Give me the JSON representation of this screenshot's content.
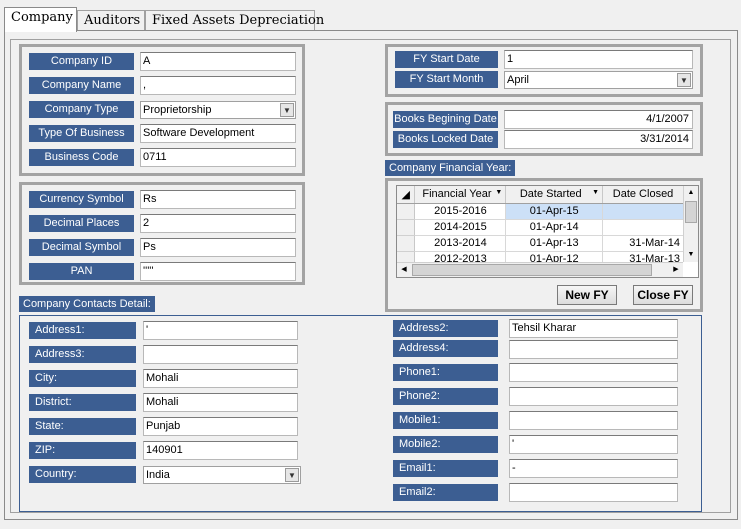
{
  "tabs": [
    "Company",
    "Auditors",
    "Fixed Assets Depreciation"
  ],
  "company_info": {
    "company_id": {
      "label": "Company ID",
      "value": "A"
    },
    "company_name": {
      "label": "Company Name",
      "value": ","
    },
    "company_type": {
      "label": "Company Type",
      "value": "Proprietorship"
    },
    "type_of_business": {
      "label": "Type Of Business",
      "value": "Software Development"
    },
    "business_code": {
      "label": "Business Code",
      "value": "0711"
    }
  },
  "currency": {
    "currency_symbol": {
      "label": "Currency Symbol",
      "value": "Rs"
    },
    "decimal_places": {
      "label": "Decimal Places",
      "value": "2"
    },
    "decimal_symbol": {
      "label": "Decimal Symbol",
      "value": "Ps"
    },
    "pan": {
      "label": "PAN",
      "value": "'''''"
    }
  },
  "fiscal": {
    "fy_start_date": {
      "label": "FY Start Date",
      "value": "1"
    },
    "fy_start_month": {
      "label": "FY Start Month",
      "value": "April"
    }
  },
  "books": {
    "begining_date": {
      "label": "Books Begining Date",
      "value": "4/1/2007"
    },
    "locked_date": {
      "label": "Books Locked Date",
      "value": "3/31/2014"
    }
  },
  "financial_year": {
    "caption": "Company Financial Year:",
    "columns": [
      "Financial Year",
      "Date Started",
      "Date Closed"
    ],
    "rows": [
      {
        "year": "2015-2016",
        "started": "01-Apr-15",
        "closed": ""
      },
      {
        "year": "2014-2015",
        "started": "01-Apr-14",
        "closed": ""
      },
      {
        "year": "2013-2014",
        "started": "01-Apr-13",
        "closed": "31-Mar-14"
      },
      {
        "year": "2012-2013",
        "started": "01-Apr-12",
        "closed": "31-Mar-13"
      }
    ],
    "new_fy": "New FY",
    "close_fy": "Close FY"
  },
  "contacts": {
    "caption": "Company Contacts Detail:",
    "address1": {
      "label": "Address1:",
      "value": "'"
    },
    "address3": {
      "label": "Address3:",
      "value": ""
    },
    "city": {
      "label": "City:",
      "value": "Mohali"
    },
    "district": {
      "label": "District:",
      "value": "Mohali"
    },
    "state": {
      "label": "State:",
      "value": "Punjab"
    },
    "zip": {
      "label": "ZIP:",
      "value": "140901"
    },
    "country": {
      "label": "Country:",
      "value": "India"
    },
    "address2": {
      "label": "Address2:",
      "value": "Tehsil Kharar"
    },
    "address4": {
      "label": "Address4:",
      "value": ""
    },
    "phone1": {
      "label": "Phone1:",
      "value": ""
    },
    "phone2": {
      "label": "Phone2:",
      "value": ""
    },
    "mobile1": {
      "label": "Mobile1:",
      "value": ""
    },
    "mobile2": {
      "label": "Mobile2:",
      "value": "'"
    },
    "email1": {
      "label": "Email1:",
      "value": "-"
    },
    "email2": {
      "label": "Email2:",
      "value": ""
    }
  },
  "colors": {
    "label_bg": "#3c5e92",
    "group_border": "#a3a3a3",
    "selected_cell": "#cce0f7"
  }
}
